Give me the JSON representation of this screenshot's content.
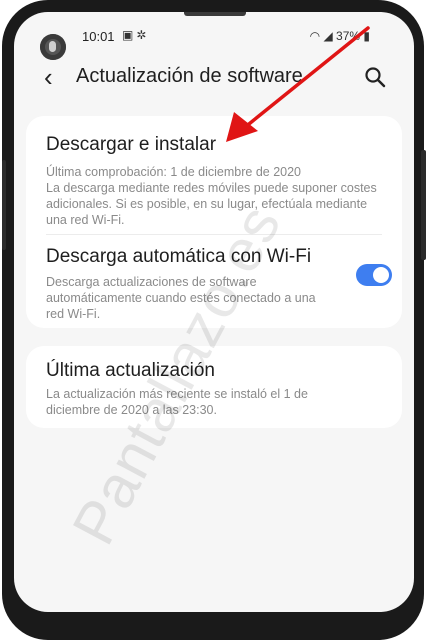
{
  "status_bar": {
    "time": "10:01",
    "battery": "37%"
  },
  "header": {
    "title": "Actualización de software"
  },
  "items": [
    {
      "title": "Descargar e instalar",
      "subtitle": "Última comprobación: 1 de diciembre de 2020\nLa descarga mediante redes móviles puede suponer costes adicionales. Si es posible, en su lugar, efectúala mediante una red Wi-Fi."
    },
    {
      "title": "Descarga automática con Wi-Fi",
      "subtitle": "Descarga actualizaciones de software automáticamente cuando estés conectado a una red Wi-Fi.",
      "toggle_on": true
    },
    {
      "title": "Última actualización",
      "subtitle": "La actualización más reciente se instaló el 1 de diciembre de 2020 a las 23:30."
    }
  ],
  "watermark": "Pantallazo.es",
  "colors": {
    "accent": "#3e7ef0",
    "arrow": "#e01515"
  }
}
